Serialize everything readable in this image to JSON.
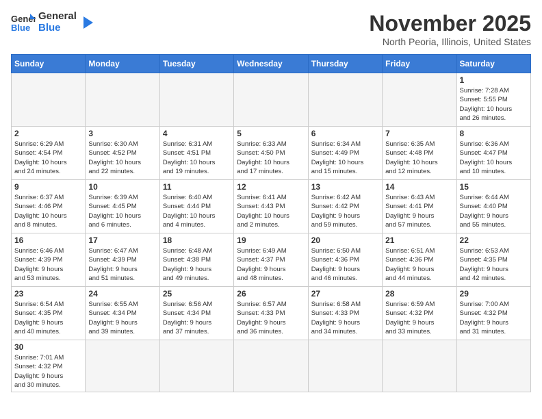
{
  "logo": {
    "text_general": "General",
    "text_blue": "Blue"
  },
  "title": "November 2025",
  "location": "North Peoria, Illinois, United States",
  "weekdays": [
    "Sunday",
    "Monday",
    "Tuesday",
    "Wednesday",
    "Thursday",
    "Friday",
    "Saturday"
  ],
  "weeks": [
    [
      {
        "day": "",
        "info": ""
      },
      {
        "day": "",
        "info": ""
      },
      {
        "day": "",
        "info": ""
      },
      {
        "day": "",
        "info": ""
      },
      {
        "day": "",
        "info": ""
      },
      {
        "day": "",
        "info": ""
      },
      {
        "day": "1",
        "info": "Sunrise: 7:28 AM\nSunset: 5:55 PM\nDaylight: 10 hours\nand 26 minutes."
      }
    ],
    [
      {
        "day": "2",
        "info": "Sunrise: 6:29 AM\nSunset: 4:54 PM\nDaylight: 10 hours\nand 24 minutes."
      },
      {
        "day": "3",
        "info": "Sunrise: 6:30 AM\nSunset: 4:52 PM\nDaylight: 10 hours\nand 22 minutes."
      },
      {
        "day": "4",
        "info": "Sunrise: 6:31 AM\nSunset: 4:51 PM\nDaylight: 10 hours\nand 19 minutes."
      },
      {
        "day": "5",
        "info": "Sunrise: 6:33 AM\nSunset: 4:50 PM\nDaylight: 10 hours\nand 17 minutes."
      },
      {
        "day": "6",
        "info": "Sunrise: 6:34 AM\nSunset: 4:49 PM\nDaylight: 10 hours\nand 15 minutes."
      },
      {
        "day": "7",
        "info": "Sunrise: 6:35 AM\nSunset: 4:48 PM\nDaylight: 10 hours\nand 12 minutes."
      },
      {
        "day": "8",
        "info": "Sunrise: 6:36 AM\nSunset: 4:47 PM\nDaylight: 10 hours\nand 10 minutes."
      }
    ],
    [
      {
        "day": "9",
        "info": "Sunrise: 6:37 AM\nSunset: 4:46 PM\nDaylight: 10 hours\nand 8 minutes."
      },
      {
        "day": "10",
        "info": "Sunrise: 6:39 AM\nSunset: 4:45 PM\nDaylight: 10 hours\nand 6 minutes."
      },
      {
        "day": "11",
        "info": "Sunrise: 6:40 AM\nSunset: 4:44 PM\nDaylight: 10 hours\nand 4 minutes."
      },
      {
        "day": "12",
        "info": "Sunrise: 6:41 AM\nSunset: 4:43 PM\nDaylight: 10 hours\nand 2 minutes."
      },
      {
        "day": "13",
        "info": "Sunrise: 6:42 AM\nSunset: 4:42 PM\nDaylight: 9 hours\nand 59 minutes."
      },
      {
        "day": "14",
        "info": "Sunrise: 6:43 AM\nSunset: 4:41 PM\nDaylight: 9 hours\nand 57 minutes."
      },
      {
        "day": "15",
        "info": "Sunrise: 6:44 AM\nSunset: 4:40 PM\nDaylight: 9 hours\nand 55 minutes."
      }
    ],
    [
      {
        "day": "16",
        "info": "Sunrise: 6:46 AM\nSunset: 4:39 PM\nDaylight: 9 hours\nand 53 minutes."
      },
      {
        "day": "17",
        "info": "Sunrise: 6:47 AM\nSunset: 4:39 PM\nDaylight: 9 hours\nand 51 minutes."
      },
      {
        "day": "18",
        "info": "Sunrise: 6:48 AM\nSunset: 4:38 PM\nDaylight: 9 hours\nand 49 minutes."
      },
      {
        "day": "19",
        "info": "Sunrise: 6:49 AM\nSunset: 4:37 PM\nDaylight: 9 hours\nand 48 minutes."
      },
      {
        "day": "20",
        "info": "Sunrise: 6:50 AM\nSunset: 4:36 PM\nDaylight: 9 hours\nand 46 minutes."
      },
      {
        "day": "21",
        "info": "Sunrise: 6:51 AM\nSunset: 4:36 PM\nDaylight: 9 hours\nand 44 minutes."
      },
      {
        "day": "22",
        "info": "Sunrise: 6:53 AM\nSunset: 4:35 PM\nDaylight: 9 hours\nand 42 minutes."
      }
    ],
    [
      {
        "day": "23",
        "info": "Sunrise: 6:54 AM\nSunset: 4:35 PM\nDaylight: 9 hours\nand 40 minutes."
      },
      {
        "day": "24",
        "info": "Sunrise: 6:55 AM\nSunset: 4:34 PM\nDaylight: 9 hours\nand 39 minutes."
      },
      {
        "day": "25",
        "info": "Sunrise: 6:56 AM\nSunset: 4:34 PM\nDaylight: 9 hours\nand 37 minutes."
      },
      {
        "day": "26",
        "info": "Sunrise: 6:57 AM\nSunset: 4:33 PM\nDaylight: 9 hours\nand 36 minutes."
      },
      {
        "day": "27",
        "info": "Sunrise: 6:58 AM\nSunset: 4:33 PM\nDaylight: 9 hours\nand 34 minutes."
      },
      {
        "day": "28",
        "info": "Sunrise: 6:59 AM\nSunset: 4:32 PM\nDaylight: 9 hours\nand 33 minutes."
      },
      {
        "day": "29",
        "info": "Sunrise: 7:00 AM\nSunset: 4:32 PM\nDaylight: 9 hours\nand 31 minutes."
      }
    ],
    [
      {
        "day": "30",
        "info": "Sunrise: 7:01 AM\nSunset: 4:32 PM\nDaylight: 9 hours\nand 30 minutes."
      },
      {
        "day": "",
        "info": ""
      },
      {
        "day": "",
        "info": ""
      },
      {
        "day": "",
        "info": ""
      },
      {
        "day": "",
        "info": ""
      },
      {
        "day": "",
        "info": ""
      },
      {
        "day": "",
        "info": ""
      }
    ]
  ]
}
